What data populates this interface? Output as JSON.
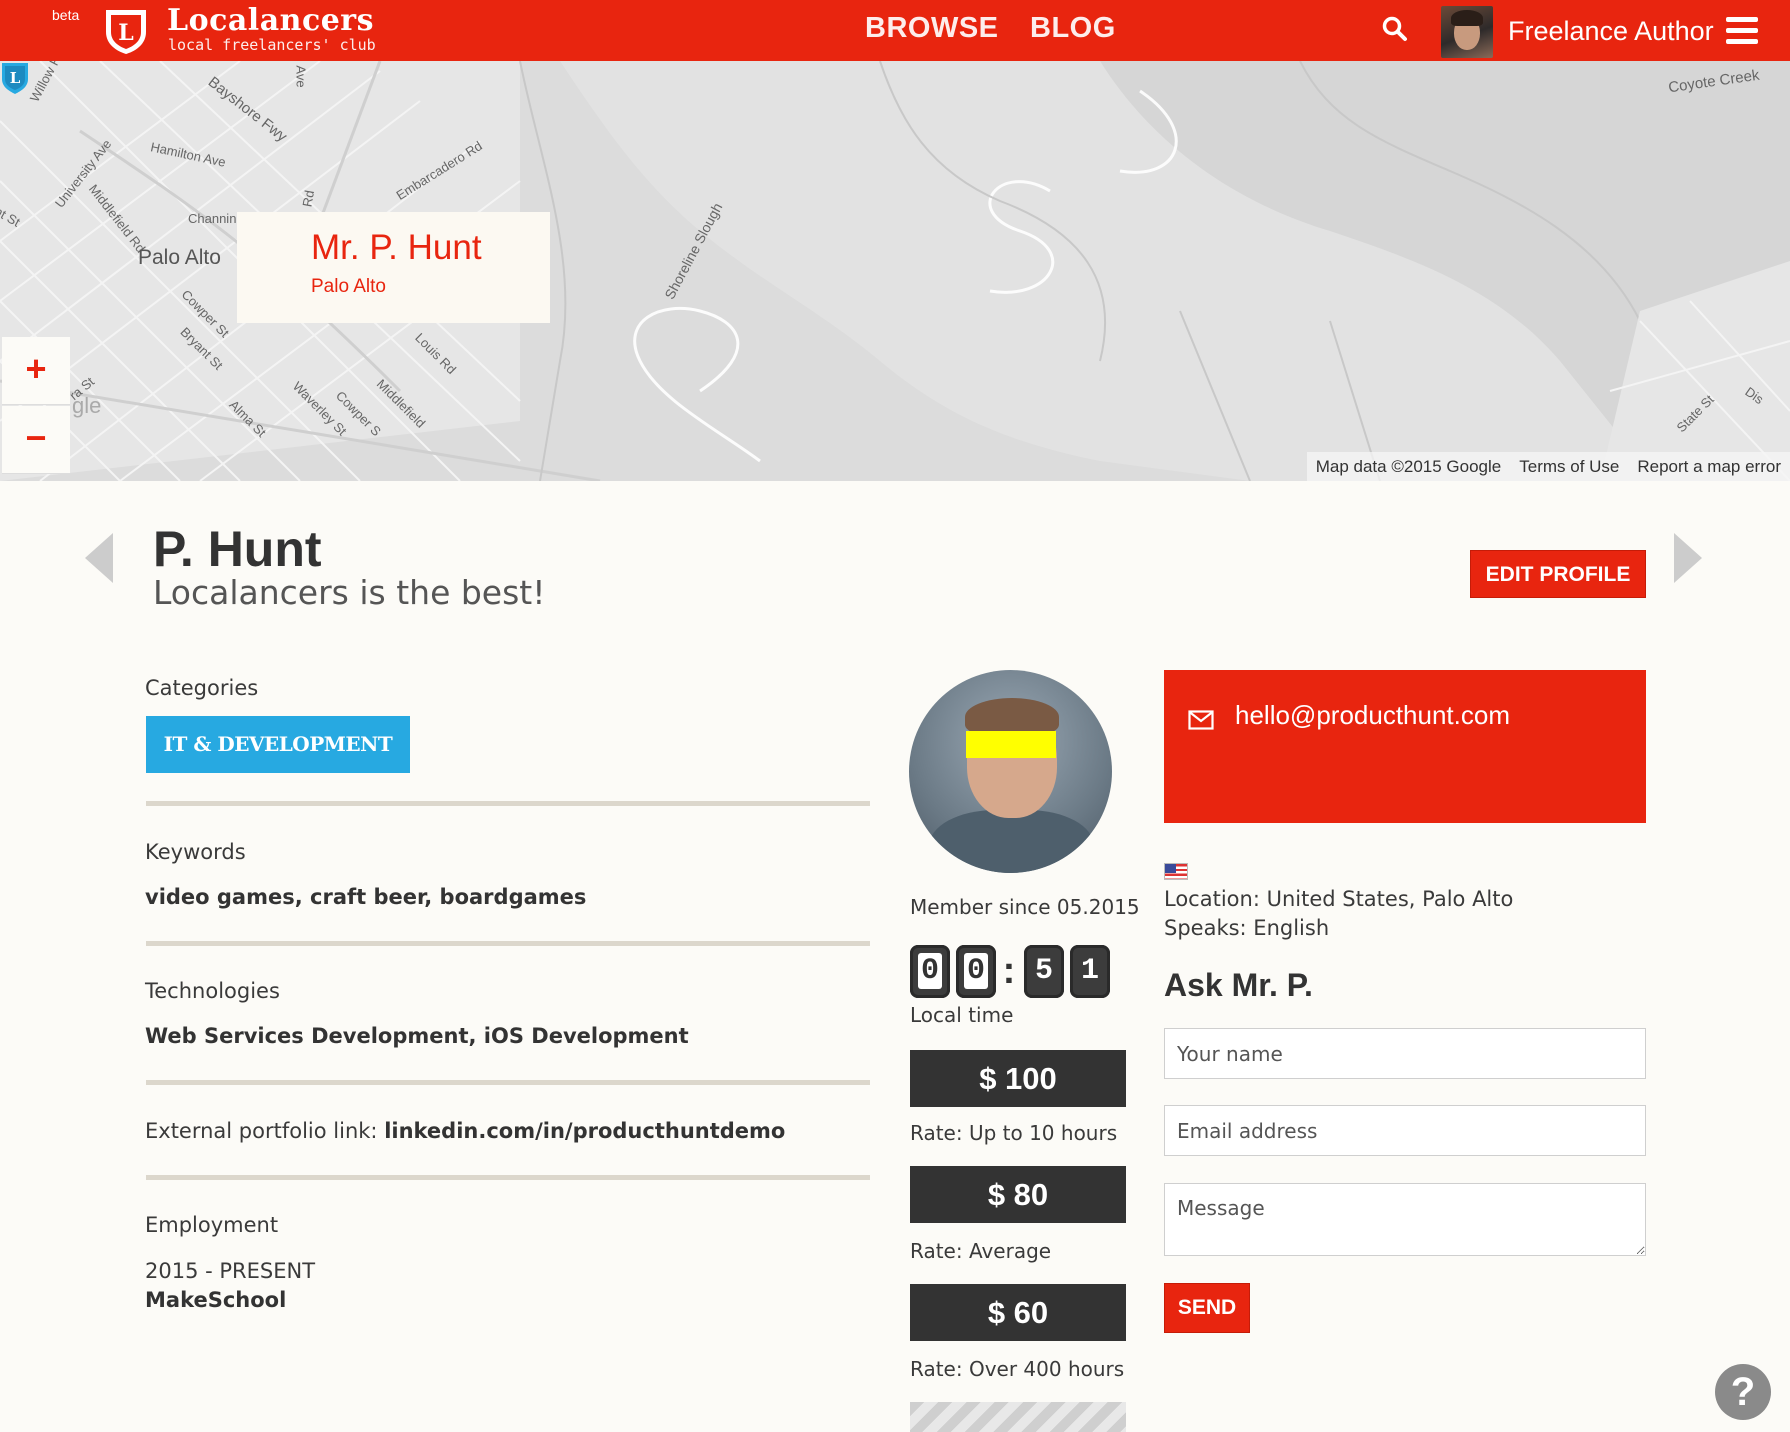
{
  "header": {
    "beta_label": "beta",
    "brand_name": "Localancers",
    "brand_subtitle": "local freelancers' club",
    "logo_letter": "L",
    "nav": [
      {
        "label": "BROWSE"
      },
      {
        "label": "BLOG"
      }
    ],
    "user_name": "Freelance Author"
  },
  "map": {
    "callout_name": "Mr. P. Hunt",
    "callout_city": "Palo Alto",
    "pin_letter": "L",
    "zoom_in": "+",
    "zoom_out": "−",
    "labels": {
      "willow": "Willow R",
      "bayshore": "Bayshore Fwy",
      "ave": "Ave",
      "hamilton": "Hamilton Ave",
      "university": "University Ave",
      "embarcadero": "Embarcadero Rd",
      "channing": "Channin",
      "middlefield_rd": "Middlefield Rd",
      "rd": "Rd",
      "palo_alto": "Palo Alto",
      "nt_st": "nt St",
      "shoreline": "Shoreline Slough",
      "cowper": "Cowper St",
      "bryant": "Bryant St",
      "louis": "Louis Rd",
      "ra_st": "ra St",
      "waverley": "Waverley St",
      "cowper2": "Cowper S",
      "middlefield2": "Middlefield",
      "alma": "Alma St",
      "coyote": "Coyote Creek",
      "state": "State St",
      "dis": "Dis",
      "gle": "gle"
    },
    "footer": [
      "Map data ©2015 Google",
      "Terms of Use",
      "Report a map error"
    ]
  },
  "profile": {
    "name": "P. Hunt",
    "tagline": "Localancers is the best!",
    "edit_label": "EDIT PROFILE"
  },
  "details": {
    "categories_label": "Categories",
    "category_tag": "IT & DEVELOPMENT",
    "keywords_label": "Keywords",
    "keywords_value": "video games, craft beer, boardgames",
    "technologies_label": "Technologies",
    "technologies_value": "Web Services Development, iOS Development",
    "portfolio_label": "External portfolio link: ",
    "portfolio_value": "linkedin.com/in/producthuntdemo",
    "employment_label": "Employment",
    "employment_period": "2015 - PRESENT",
    "employment_company": "MakeSchool"
  },
  "sidebar": {
    "member_since": "Member since 05.2015",
    "clock": [
      "0",
      "0",
      "5",
      "1"
    ],
    "clock_sep": ":",
    "local_time_label": "Local time",
    "rates": [
      {
        "value": "$ 100",
        "label": "Rate: Up to 10 hours"
      },
      {
        "value": "$ 80",
        "label": "Rate: Average"
      },
      {
        "value": "$ 60",
        "label": "Rate: Over 400 hours"
      }
    ]
  },
  "contact": {
    "email": "hello@producthunt.com",
    "location": "Location: United States, Palo Alto",
    "speaks": "Speaks: English",
    "ask_title": "Ask Mr. P.",
    "name_placeholder": "Your name",
    "email_placeholder": "Email address",
    "message_placeholder": "Message",
    "send_label": "SEND"
  },
  "help_label": "?",
  "colors": {
    "accent": "#e8250f",
    "category": "#27a9e1",
    "rate_bg": "#333333"
  }
}
